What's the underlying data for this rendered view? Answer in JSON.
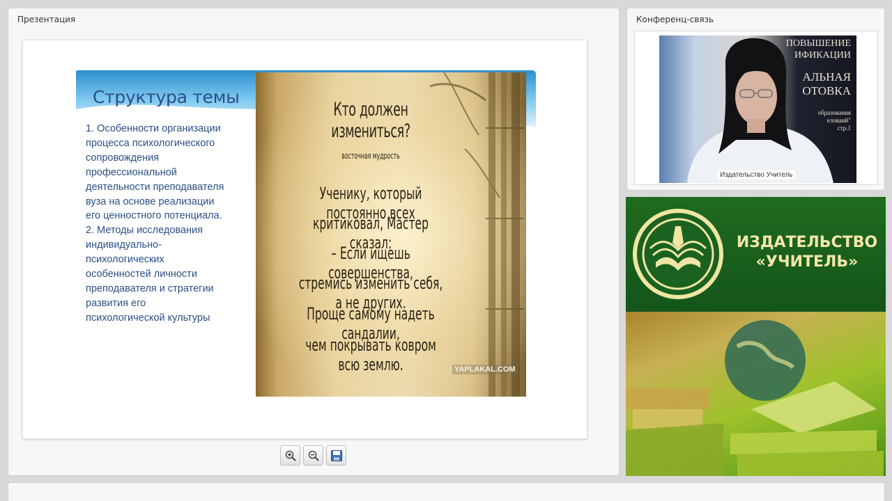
{
  "presentation_panel": {
    "title": "Презентация"
  },
  "slide": {
    "title": "Структура темы",
    "body": "1. Особенности организации процесса психологического сопровождения профессиональной деятельности преподавателя вуза на основе реализации его ценностного потенциала. 2. Методы исследования индивидуально-психологических особенностей личности преподавателя и стратегии развития его психологической культуры",
    "body_lines": [
      "1. Особенности организации",
      "процесса психологического",
      "сопровождения",
      "профессиональной",
      "деятельности преподавателя",
      "вуза на основе реализации",
      "его ценностного потенциала.",
      "2. Методы исследования",
      "индивидуально-",
      "психологических",
      "особенностей личности",
      "преподавателя и стратегии",
      "развития его",
      "психологической культуры"
    ],
    "image": {
      "title": "Кто должен измениться?",
      "subtitle": "восточная мудрость",
      "lines": [
        "Ученику, который постоянно всех",
        "критиковал, Мастер сказал:",
        "– Если ищешь совершенства,",
        "стремись изменить себя, а не других.",
        "Проще самому надеть сандалии,",
        "чем покрывать ковром всю землю."
      ],
      "watermark": "YAPLAKAL.COM"
    }
  },
  "toolbar": {
    "zoom_in_icon": "zoom-in-icon",
    "zoom_out_icon": "zoom-out-icon",
    "save_icon": "save-icon"
  },
  "conference_panel": {
    "title": "Конференц-связь",
    "participant_label": "Издательство Учитель",
    "background_book_text": [
      "ПОВЫШЕНИЕ",
      "ИФИКАЦИИ",
      "АЛЬНАЯ",
      "ОТОВКА",
      "образования",
      "еловаий\"",
      "стр.1"
    ]
  },
  "publisher": {
    "name_line1": "ИЗДАТЕЛЬСТВО",
    "name_line2": "«УЧИТЕЛЬ»",
    "brand_color": "#1a5f1c",
    "text_color": "#f3e7a8"
  }
}
